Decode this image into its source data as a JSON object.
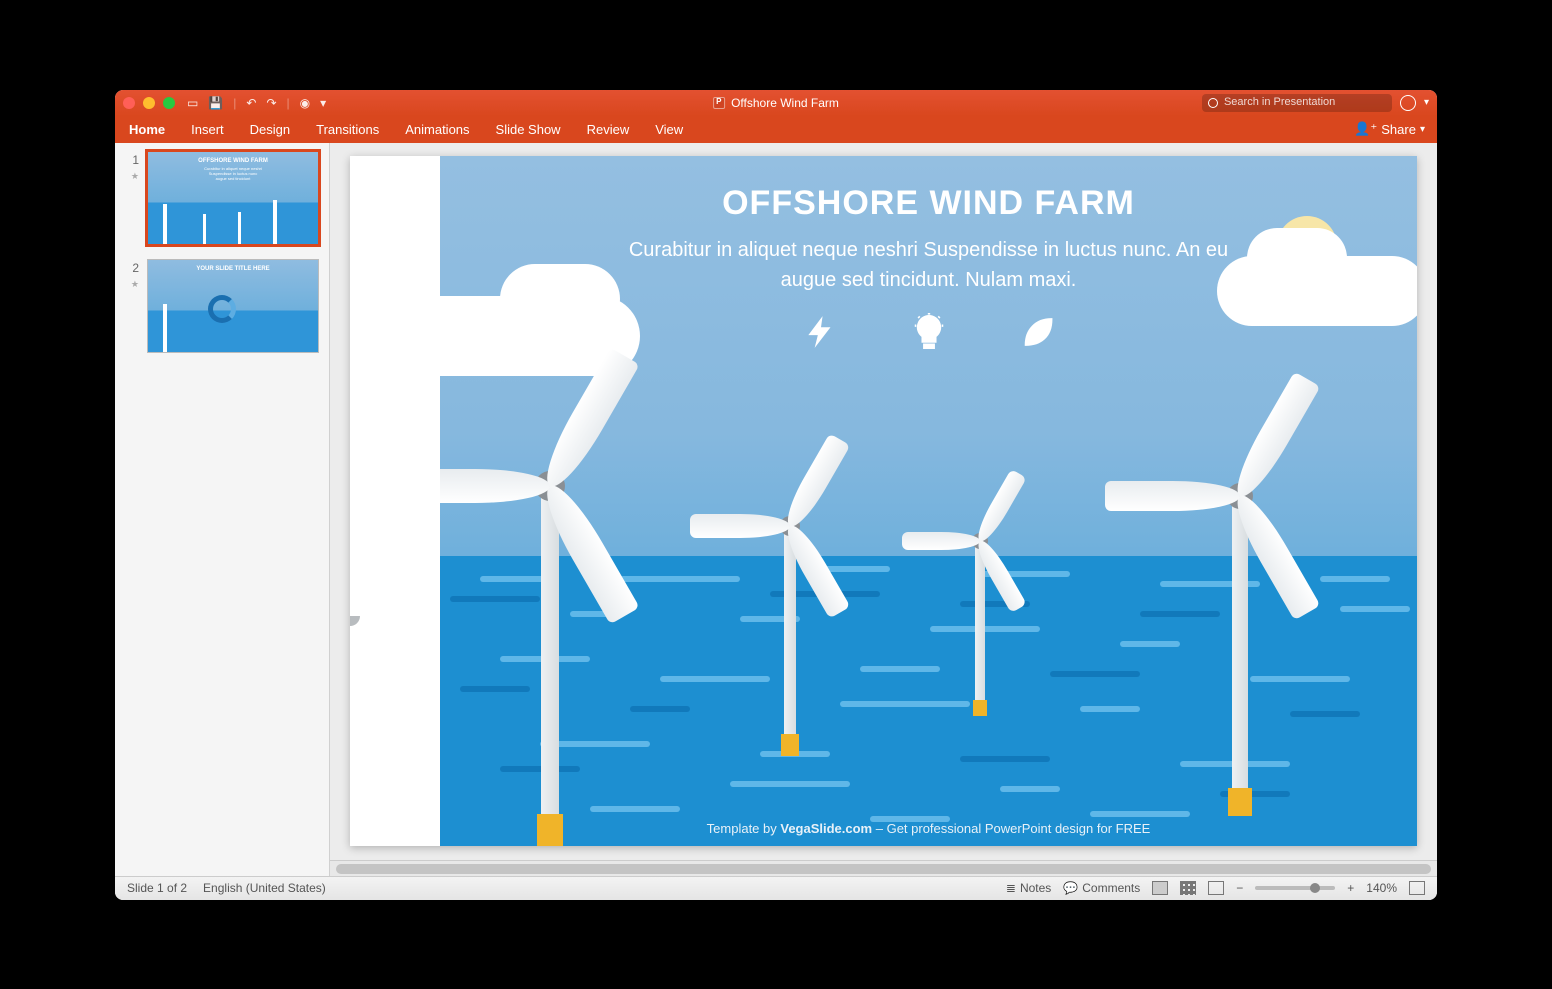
{
  "window": {
    "title": "Offshore Wind Farm"
  },
  "search": {
    "placeholder": "Search in Presentation"
  },
  "ribbon": {
    "tabs": [
      "Home",
      "Insert",
      "Design",
      "Transitions",
      "Animations",
      "Slide Show",
      "Review",
      "View"
    ],
    "share": "Share"
  },
  "thumbs": {
    "s1": {
      "num": "1",
      "title": "OFFSHORE WIND FARM"
    },
    "s2": {
      "num": "2",
      "title": "YOUR SLIDE TITLE HERE"
    }
  },
  "slide": {
    "title": "OFFSHORE WIND FARM",
    "subtitle": "Curabitur in aliquet neque neshri Suspendisse in luctus nunc. An eu augue sed tincidunt. Nulam maxi.",
    "icons": [
      "bolt-icon",
      "bulb-icon",
      "leaf-icon"
    ],
    "footer_pre": "Template by ",
    "footer_link": "VegaSlide.com",
    "footer_post": " – Get professional PowerPoint design for FREE"
  },
  "status": {
    "slide": "Slide 1 of 2",
    "lang": "English (United States)",
    "notes": "Notes",
    "comments": "Comments",
    "zoom": "140%"
  }
}
